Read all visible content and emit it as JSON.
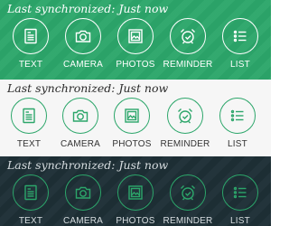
{
  "panels": [
    {
      "theme": "green",
      "sync_text": "Last synchronized: Just now",
      "buttons": [
        {
          "label": "TEXT",
          "icon": "text-note-icon"
        },
        {
          "label": "CAMERA",
          "icon": "camera-icon"
        },
        {
          "label": "PHOTOS",
          "icon": "photo-icon"
        },
        {
          "label": "REMINDER",
          "icon": "alarm-clock-icon"
        },
        {
          "label": "LIST",
          "icon": "checklist-icon"
        }
      ]
    },
    {
      "theme": "light",
      "sync_text": "Last synchronized: Just now",
      "buttons": [
        {
          "label": "TEXT",
          "icon": "text-note-icon"
        },
        {
          "label": "CAMERA",
          "icon": "camera-icon"
        },
        {
          "label": "PHOTOS",
          "icon": "photo-icon"
        },
        {
          "label": "REMINDER",
          "icon": "alarm-clock-icon"
        },
        {
          "label": "LIST",
          "icon": "checklist-icon"
        }
      ]
    },
    {
      "theme": "dark",
      "sync_text": "Last synchronized: Just now",
      "buttons": [
        {
          "label": "TEXT",
          "icon": "text-note-icon"
        },
        {
          "label": "CAMERA",
          "icon": "camera-icon"
        },
        {
          "label": "PHOTOS",
          "icon": "photo-icon"
        },
        {
          "label": "REMINDER",
          "icon": "alarm-clock-icon"
        },
        {
          "label": "LIST",
          "icon": "checklist-icon"
        }
      ]
    }
  ],
  "colors": {
    "green_bg": "#2ca66a",
    "light_bg": "#f6f6f6",
    "dark_bg": "#1e2f36",
    "accent": "#2ca66a"
  }
}
